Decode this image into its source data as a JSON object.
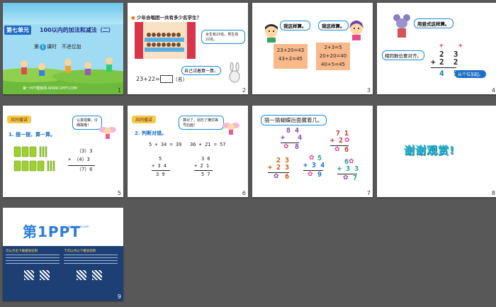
{
  "slides": [
    {
      "number": "1",
      "unit": "第七单元",
      "title": "100以内的加法和减法（二）",
      "lesson_prefix": "第",
      "lesson_num": "1",
      "lesson_suffix": "课时",
      "lesson_topic": "不进位加",
      "footer": "第一PPT模板网-WWW.1PPT.COM"
    },
    {
      "number": "2",
      "question": "少年合唱团一共有多少名学生？",
      "speech": "女生有23名，男生有22名。",
      "equation": "23+22=",
      "unit_label": "（名）",
      "try_label": "自己试着算一算。"
    },
    {
      "number": "3",
      "left_bubble": "我这样算。",
      "right_bubble": "我这样算。",
      "left_box": [
        "23+20=43",
        "43+2=45"
      ],
      "right_box": [
        "2+3=5",
        "20+20=40",
        "40+5=45"
      ]
    },
    {
      "number": "4",
      "bubble_top": "用竖式这样算。",
      "bubble_mid": "相同数位要对齐。",
      "bubble_bottom": "从个位加起。",
      "plus_top": "+",
      "plus_top2": "+",
      "row1": "2  3",
      "sign": "+",
      "row2": "2  2",
      "row3": "4  5"
    },
    {
      "number": "5",
      "tag": "共同播讲",
      "heading": "1. 摆一摆，算一算。",
      "bubble": "认真观察，仔细摆哦！",
      "lines": [
        "（3）3",
        "+ （4）3",
        "（7）6"
      ]
    },
    {
      "number": "6",
      "tag": "共同播讲",
      "heading": "2. 判断对错。",
      "bubble": "算对了，别忘了横式等号后面！",
      "eq1": "5 + 34 = 39",
      "eq2": "36 + 21 = 57",
      "col1": [
        "5",
        "+ 3 4",
        "3 9"
      ],
      "col2": [
        "3 6",
        "+ 2 1",
        "5 7"
      ]
    },
    {
      "number": "7",
      "heading": "猜一猜蝴蝶后面藏着几。",
      "p1": [
        "8 4",
        "+   4",
        "  8"
      ],
      "p2": [
        "7 1",
        "+ 2",
        "  6"
      ],
      "p3": [
        "2 3",
        "+ 2 3",
        "  6"
      ],
      "p4": [
        "  5",
        "+ 3 4",
        "  9"
      ],
      "p5": [
        "6",
        "+ 3 3",
        "  7"
      ]
    },
    {
      "number": "8",
      "thanks": "谢谢观赏!"
    },
    {
      "number": "9",
      "logo": "第1PPT",
      "logo_sub": "www.1ppt.com",
      "info_left": "可以点击下载播放说明",
      "info_right": "下可以点以下播放说明"
    }
  ],
  "colors": {
    "bg": "#585858",
    "blue": "#1a6fc4",
    "orange": "#f9b98a",
    "teal": "#2ab8d6"
  }
}
